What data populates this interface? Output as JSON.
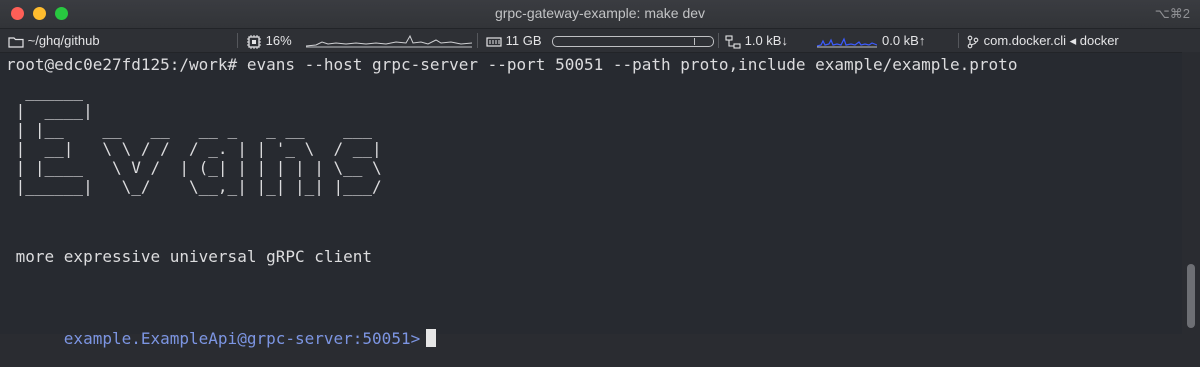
{
  "window": {
    "title": "grpc-gateway-example: make dev",
    "shortcut": "⌥⌘2"
  },
  "statusbar": {
    "path": "~/ghq/github",
    "cpu": "16%",
    "memory": "11 GB",
    "download": "1.0 kB↓",
    "upload": "0.0 kB↑",
    "context": "com.docker.cli ◂ docker",
    "icons": [
      "folder-icon",
      "cpu-icon",
      "memory-icon",
      "network-icon",
      "git-branch-icon"
    ]
  },
  "terminal": {
    "command_line": "root@edc0e27fd125:/work# evans --host grpc-server --port 50051 --path proto,include example/example.proto",
    "ascii_art": "  ______\n |  ____|\n | |__    __   __   __ _   _ __    ___\n |  __|   \\ \\ / /  / _. | | '_ \\  / __|\n | |____   \\ V /  | (_| | | | | | \\__ \\\n |______|   \\_/    \\__,_| |_| |_| |___/",
    "tagline": " more expressive universal gRPC client",
    "prompt": "example.ExampleApi@grpc-server:50051>",
    "colors": {
      "prompt": "#7c95e2",
      "text": "#dcdcde",
      "background": "#272a30"
    }
  }
}
